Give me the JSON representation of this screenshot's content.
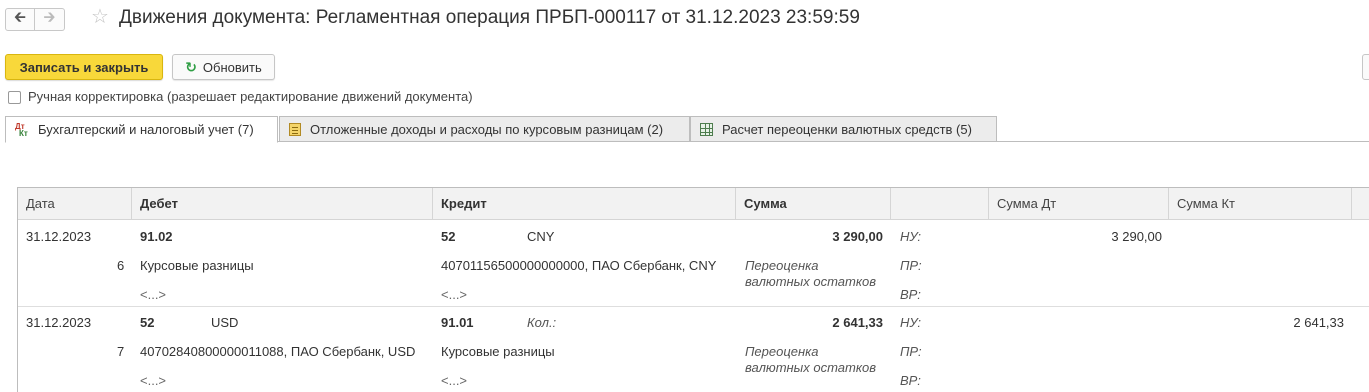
{
  "window": {
    "title": "Движения документа: Регламентная операция ПРБП-000117 от 31.12.2023 23:59:59",
    "back_icon": "arrow-left-icon",
    "forward_icon": "arrow-right-icon",
    "favorite_icon": "star-icon"
  },
  "toolbar": {
    "save_close_label": "Записать и закрыть",
    "refresh_label": "Обновить",
    "refresh_icon": "refresh-icon"
  },
  "manual_edit": {
    "checked": false,
    "label": "Ручная корректировка (разрешает редактирование движений документа)"
  },
  "tabs": [
    {
      "label": "Бухгалтерский и налоговый учет (7)",
      "icon": "dt-kt-icon",
      "active": true
    },
    {
      "label": "Отложенные доходы и расходы по курсовым разницам (2)",
      "icon": "document-icon",
      "active": false
    },
    {
      "label": "Расчет переоценки валютных средств (5)",
      "icon": "table-icon",
      "active": false
    }
  ],
  "table": {
    "columns": [
      "Дата",
      "Дебет",
      "Кредит",
      "Сумма",
      "",
      "Сумма Дт",
      "Сумма Кт"
    ],
    "rows": [
      {
        "date": "31.12.2023",
        "debit_account": "91.02",
        "debit_currency": "",
        "debit_line_num": "6",
        "debit_subconto1": "Курсовые разницы",
        "debit_subconto2": "<...>",
        "credit_account": "52",
        "credit_currency": "CNY",
        "credit_qty_label": "",
        "credit_subconto1": "40701156500000000000, ПАО Сбербанк, CNY",
        "credit_subconto2": "<...>",
        "amount": "3 290,00",
        "content_line1": "Переоценка",
        "content_line2": "валютных остатков",
        "nu_label": "НУ:",
        "pr_label": "ПР:",
        "vr_label": "ВР:",
        "sum_dt": "3 290,00",
        "sum_kt": ""
      },
      {
        "date": "31.12.2023",
        "debit_account": "52",
        "debit_currency": "USD",
        "debit_line_num": "7",
        "debit_subconto1": "40702840800000011088, ПАО Сбербанк, USD",
        "debit_subconto2": "<...>",
        "credit_account": "91.01",
        "credit_currency": "",
        "credit_qty_label": "Кол.:",
        "credit_subconto1": "Курсовые разницы",
        "credit_subconto2": "<...>",
        "amount": "2 641,33",
        "content_line1": "Переоценка",
        "content_line2": "валютных остатков",
        "nu_label": "НУ:",
        "pr_label": "ПР:",
        "vr_label": "ВР:",
        "sum_dt": "",
        "sum_kt": "2 641,33"
      }
    ]
  }
}
